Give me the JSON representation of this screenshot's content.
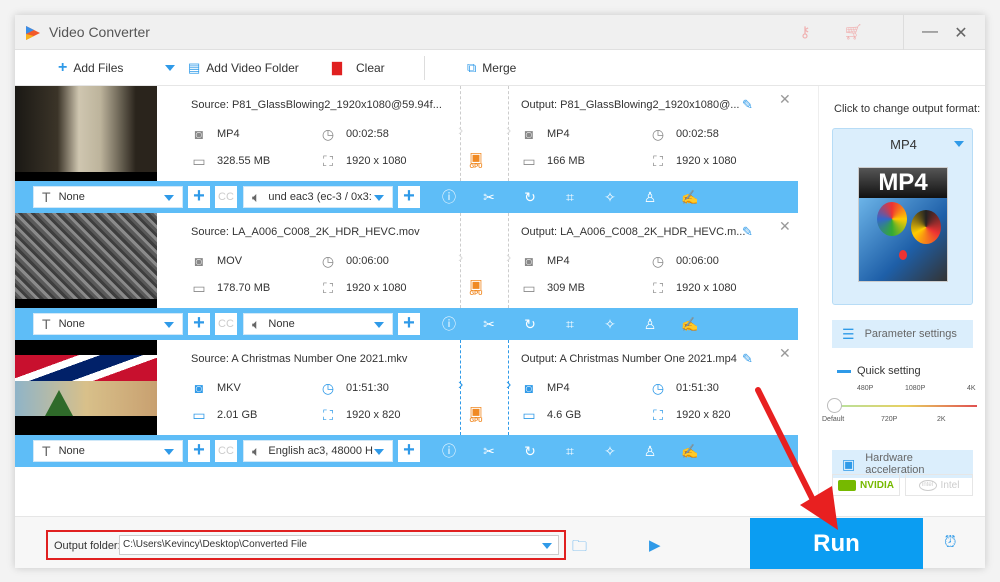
{
  "app": {
    "title": "Video Converter"
  },
  "titlebar": {
    "icons": [
      "key-icon",
      "cart-icon",
      "minimize-icon",
      "close-icon"
    ],
    "minimize": "—",
    "close": "✕"
  },
  "toolbar": {
    "add_files": "Add Files",
    "add_folder": "Add Video Folder",
    "clear": "Clear",
    "merge": "Merge"
  },
  "files": [
    {
      "source": "Source: P81_GlassBlowing2_1920x1080@59.94f...",
      "output": "Output: P81_GlassBlowing2_1920x1080@...",
      "src_format": "MP4",
      "src_duration": "00:02:58",
      "src_size": "328.55 MB",
      "src_resolution": "1920 x 1080",
      "out_format": "MP4",
      "out_duration": "00:02:58",
      "out_size": "166 MB",
      "out_resolution": "1920 x 1080",
      "subtitle": "None",
      "audio": "und eac3 (ec-3 / 0x3:",
      "gpu": "GPU",
      "active": false
    },
    {
      "source": "Source: LA_A006_C008_2K_HDR_HEVC.mov",
      "output": "Output: LA_A006_C008_2K_HDR_HEVC.m...",
      "src_format": "MOV",
      "src_duration": "00:06:00",
      "src_size": "178.70 MB",
      "src_resolution": "1920 x 1080",
      "out_format": "MP4",
      "out_duration": "00:06:00",
      "out_size": "309 MB",
      "out_resolution": "1920 x 1080",
      "subtitle": "None",
      "audio": "None",
      "gpu": "GPU",
      "active": false
    },
    {
      "source": "Source: A Christmas Number One 2021.mkv",
      "output": "Output: A Christmas Number One 2021.mp4",
      "src_format": "MKV",
      "src_duration": "01:51:30",
      "src_size": "2.01 GB",
      "src_resolution": "1920 x 820",
      "out_format": "MP4",
      "out_duration": "01:51:30",
      "out_size": "4.6 GB",
      "out_resolution": "1920 x 820",
      "subtitle": "None",
      "audio": "English ac3, 48000 H",
      "gpu": "GPU",
      "active": true
    }
  ],
  "cc_label": "CC",
  "panel": {
    "label": "Click to change output format:",
    "format": "MP4",
    "format_image_text": "MP4",
    "parameter_settings": "Parameter settings",
    "quick_setting": "Quick setting",
    "quality_top": [
      "480P",
      "1080P",
      "4K"
    ],
    "quality_bottom": [
      "Default",
      "720P",
      "2K"
    ],
    "quality_selected": "Default",
    "hardware_acceleration": "Hardware acceleration",
    "nvidia": "NVIDIA",
    "intel": "Intel"
  },
  "footer": {
    "output_label": "Output folder:",
    "output_path": "C:\\Users\\Kevincy\\Desktop\\Converted File",
    "run": "Run"
  },
  "colors": {
    "accent": "#0b9df2",
    "bar": "#5ebdf7",
    "gpu": "#f08a24",
    "annotation": "#e02020"
  }
}
